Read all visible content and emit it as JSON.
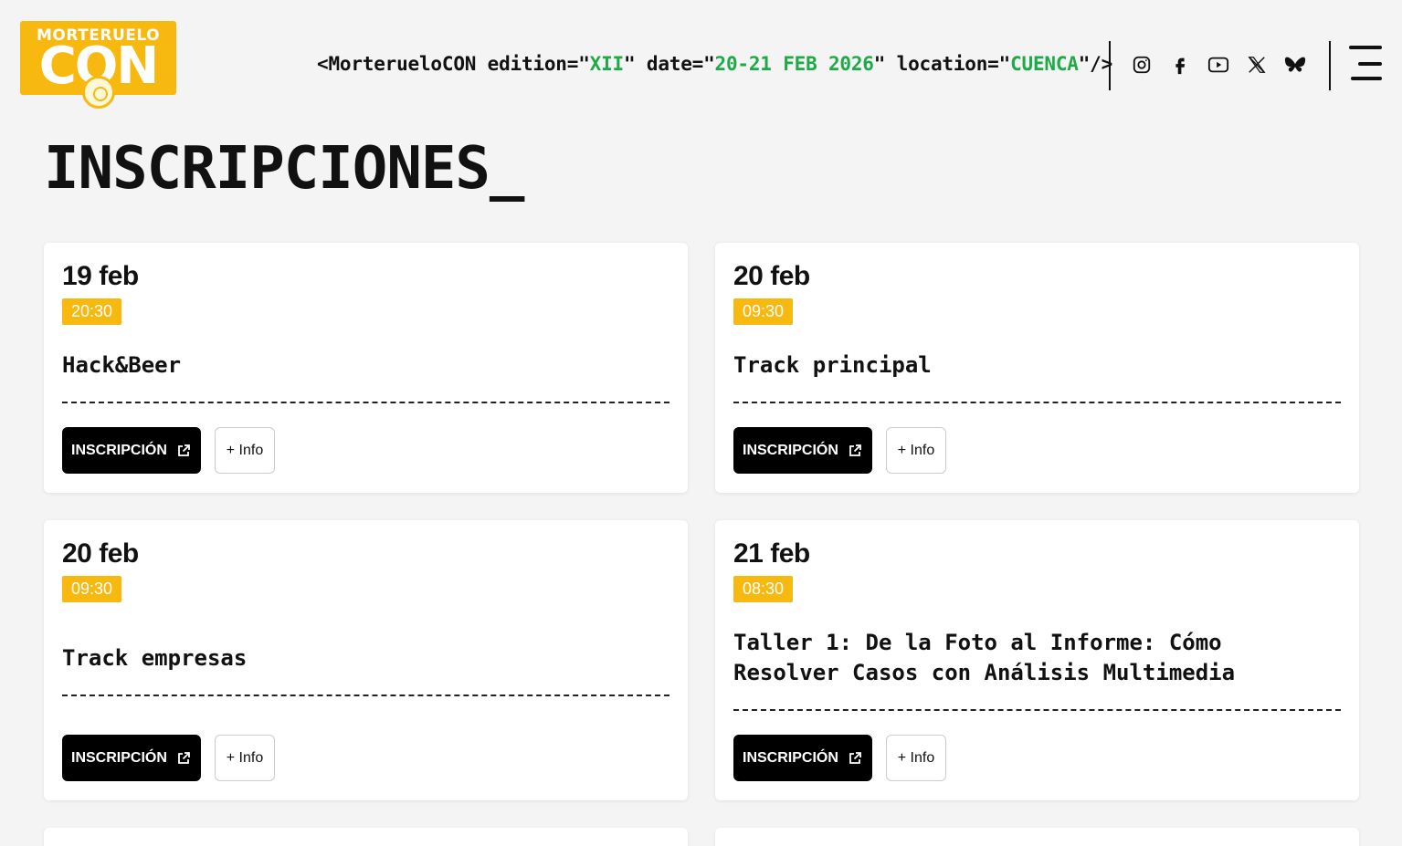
{
  "header": {
    "logo_top": "MORTERUELO",
    "logo_main": "CON",
    "tag_open": "<MorteruelCON",
    "tag_parts": {
      "p1": "<MorteruelоCON edition=\"",
      "edition": "XII",
      "p2": "\" date=\"",
      "date": "20-21 FEB 2026",
      "p3": "\" location=\"",
      "location": "CUENCA",
      "p4": "\"/>"
    },
    "socials": [
      "instagram-icon",
      "facebook-icon",
      "youtube-icon",
      "x-icon",
      "bluesky-icon"
    ]
  },
  "page_title": "INSCRIPCIONES_",
  "cards": [
    {
      "date": "19 feb",
      "time": "20:30",
      "title": "Hack&Beer",
      "register": "INSCRIPCIÓN",
      "info": "+ Info"
    },
    {
      "date": "20 feb",
      "time": "09:30",
      "title": "Track principal",
      "register": "INSCRIPCIÓN",
      "info": "+ Info"
    },
    {
      "date": "20 feb",
      "time": "09:30",
      "title": "Track empresas",
      "register": "INSCRIPCIÓN",
      "info": "+ Info"
    },
    {
      "date": "21 feb",
      "time": "08:30",
      "title": "Taller 1: De la Foto al Informe: Cómo Resolver Casos con Análisis Multimedia",
      "register": "INSCRIPCIÓN",
      "info": "+ Info"
    }
  ],
  "colors": {
    "accent": "#f7b90f",
    "code_value": "#1faa47",
    "button": "#000000"
  }
}
